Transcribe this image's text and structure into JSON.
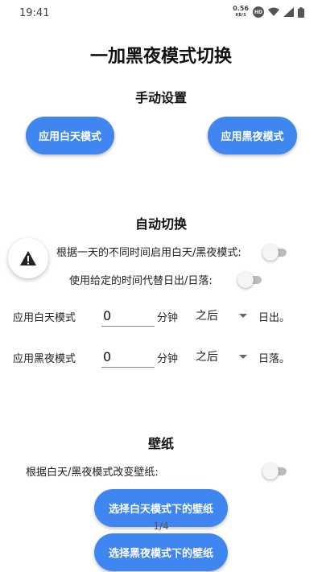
{
  "status": {
    "time": "19:41",
    "net_speed": "0.56",
    "net_unit": "KB/S",
    "hd": "HD"
  },
  "app": {
    "title": "一加黑夜模式切换"
  },
  "manual": {
    "title": "手动设置",
    "day_button": "应用白天模式",
    "night_button": "应用黑夜模式"
  },
  "auto": {
    "title": "自动切换",
    "schedule_label": "根据一天的不同时间启用白天/黑夜模式:",
    "custom_time_label": "使用给定的时间代替日出/日落:",
    "day_row": {
      "label": "应用白天模式",
      "value": "0",
      "unit": "分钟",
      "relation": "之后",
      "event": "日出。"
    },
    "night_row": {
      "label": "应用黑夜模式",
      "value": "0",
      "unit": "分钟",
      "relation": "之后",
      "event": "日落。"
    }
  },
  "wallpaper": {
    "title": "壁纸",
    "change_label": "根据白天/黑夜模式改变壁纸:",
    "day_button": "选择白天模式下的壁纸",
    "night_button": "选择黑夜模式下的壁纸"
  },
  "pager": {
    "indicator": "1/4"
  },
  "colors": {
    "accent": "#3f86f0",
    "switch_off": "#bdbdbd"
  },
  "icons": {
    "fab": "warning-icon"
  }
}
